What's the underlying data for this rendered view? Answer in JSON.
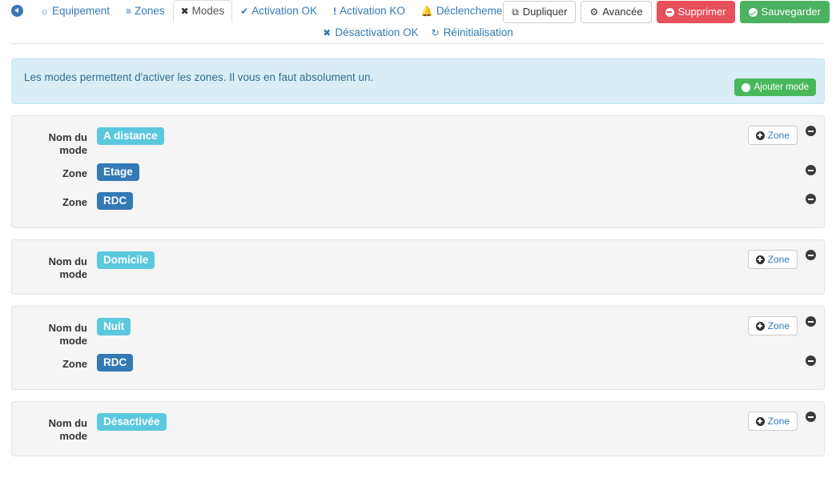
{
  "nav": {
    "back_icon": "back-circle-icon",
    "tabs": [
      {
        "label": "Equipement",
        "icon": "dashboard-icon",
        "glyph": "◔",
        "active": false
      },
      {
        "label": "Zones",
        "icon": "list-icon",
        "glyph": "≡",
        "active": false
      },
      {
        "label": "Modes",
        "icon": "modes-icon",
        "glyph": "✖",
        "active": true
      },
      {
        "label": "Activation OK",
        "icon": "check-icon",
        "glyph": "✔",
        "active": false
      },
      {
        "label": "Activation KO",
        "icon": "exclamation-icon",
        "glyph": "!",
        "active": false
      },
      {
        "label": "Déclenchement",
        "icon": "bell-icon",
        "glyph": "ὑ4",
        "active": false
      }
    ],
    "subnav": [
      {
        "label": "Désactivation OK",
        "icon": "cross-icon",
        "glyph": "✖"
      },
      {
        "label": "Réinitialisation",
        "icon": "refresh-icon",
        "glyph": "↻"
      }
    ]
  },
  "actions": {
    "duplicate": "Dupliquer",
    "advanced": "Avancée",
    "delete": "Supprimer",
    "save": "Sauvegarder"
  },
  "alert": {
    "text": "Les modes permettent d'activer les zones. Il vous en faut absolument un.",
    "add_mode_label": "Ajouter mode"
  },
  "labels": {
    "mode_name": "Nom du mode",
    "zone": "Zone",
    "add_zone": "Zone"
  },
  "modes": [
    {
      "name": "A distance",
      "zones": [
        "Etage",
        "RDC"
      ]
    },
    {
      "name": "Domicile",
      "zones": []
    },
    {
      "name": "Nuit",
      "zones": [
        "RDC"
      ]
    },
    {
      "name": "Désactivée",
      "zones": []
    }
  ],
  "colors": {
    "brand_blue": "#337ab7",
    "mode_badge": "#5bc8de",
    "zone_badge": "#3379b5",
    "success": "#4cb160",
    "danger": "#e8505b",
    "alert_bg": "#d9edf7",
    "alert_border": "#bce8f1",
    "alert_text": "#31708f",
    "panel_bg": "#f5f5f5"
  }
}
